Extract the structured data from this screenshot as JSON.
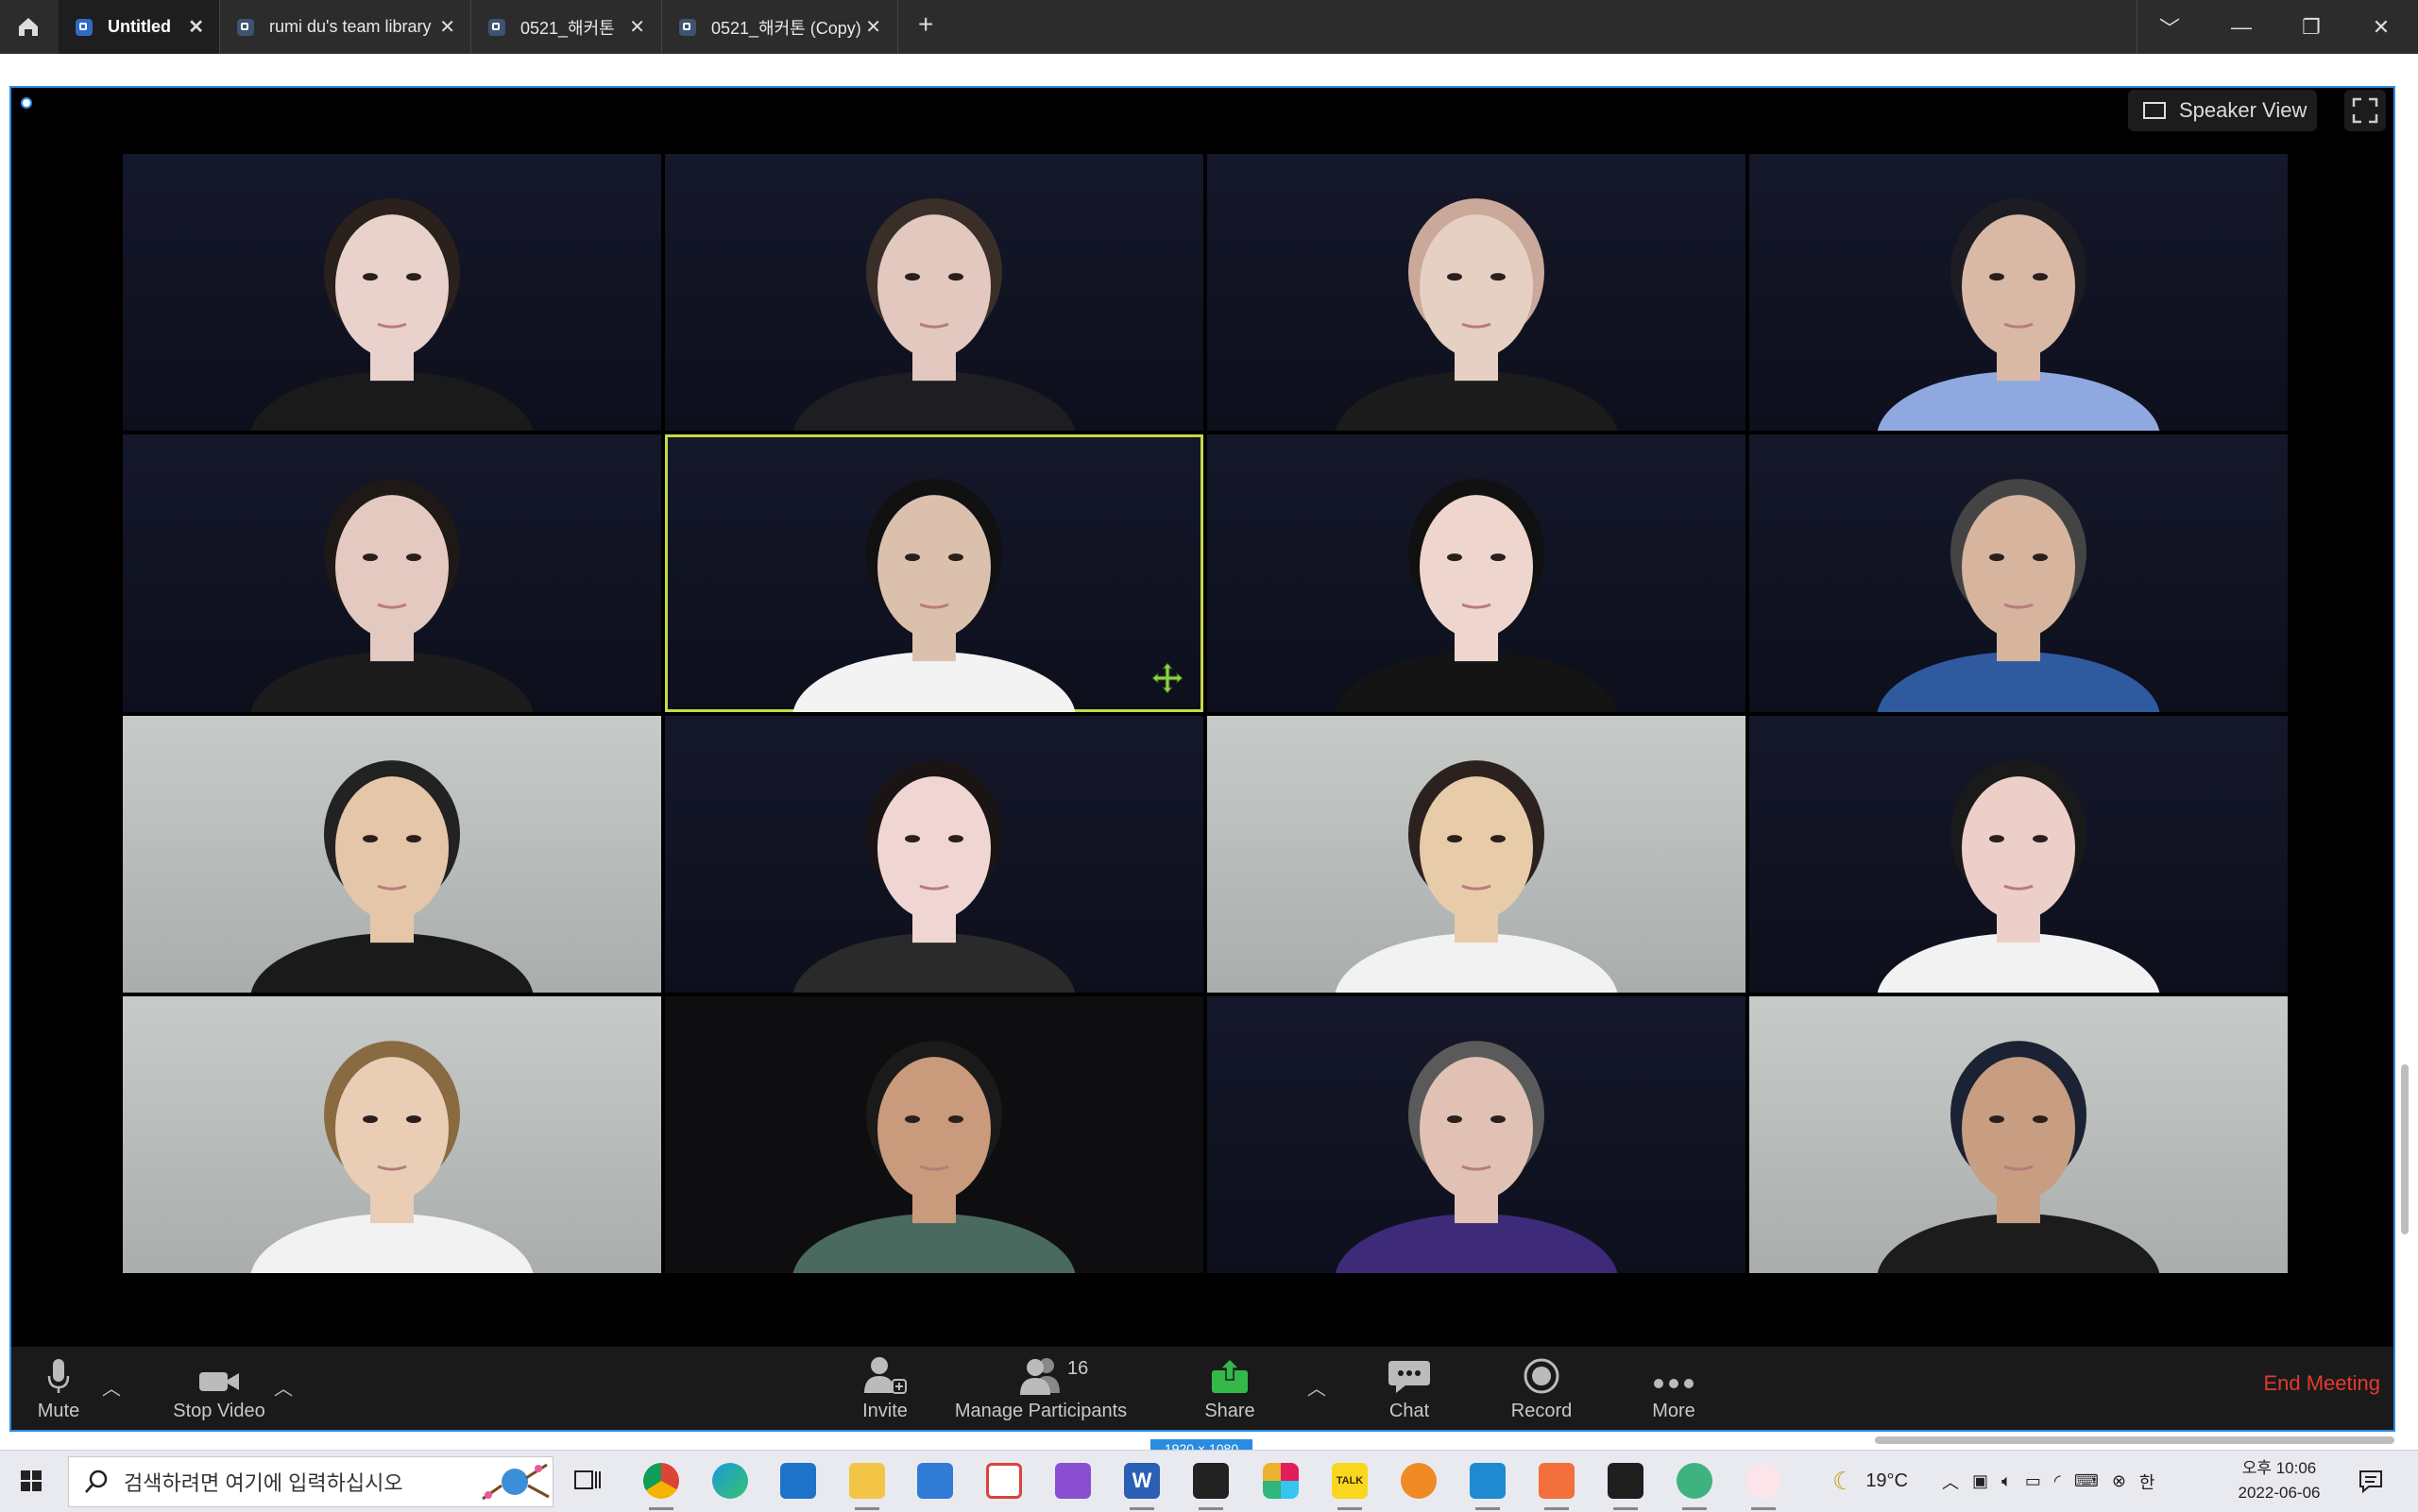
{
  "tabs": [
    {
      "label": "Untitled",
      "active": true
    },
    {
      "label": "rumi du's team library",
      "active": false
    },
    {
      "label": "0521_해커톤",
      "active": false
    },
    {
      "label": "0521_해커톤 (Copy)",
      "active": false
    }
  ],
  "window_controls": {
    "new_tab": "+",
    "dropdown": "﹀",
    "minimize": "—",
    "restore": "❐",
    "close": "✕"
  },
  "view": {
    "speaker_view_label": "Speaker View"
  },
  "participants_grid": {
    "rows": 4,
    "cols": 4,
    "active_speaker_index": 5
  },
  "toolbar": {
    "mute": "Mute",
    "stop_video": "Stop Video",
    "invite": "Invite",
    "manage_participants": "Manage Participants",
    "participant_count": "16",
    "share": "Share",
    "chat": "Chat",
    "record": "Record",
    "more": "More",
    "end_meeting": "End Meeting"
  },
  "frame_size_badge": "1920 × 1080",
  "taskbar": {
    "search_placeholder": "검색하려면 여기에 입력하십시오",
    "temperature": "19°C",
    "ime": "한",
    "time": "오후 10:06",
    "date": "2022-06-06"
  },
  "colors": {
    "accent_blue": "#2a8ce0",
    "end_meeting_red": "#e23a2f",
    "share_green": "#35b84a",
    "active_border": "#c4d84a"
  }
}
